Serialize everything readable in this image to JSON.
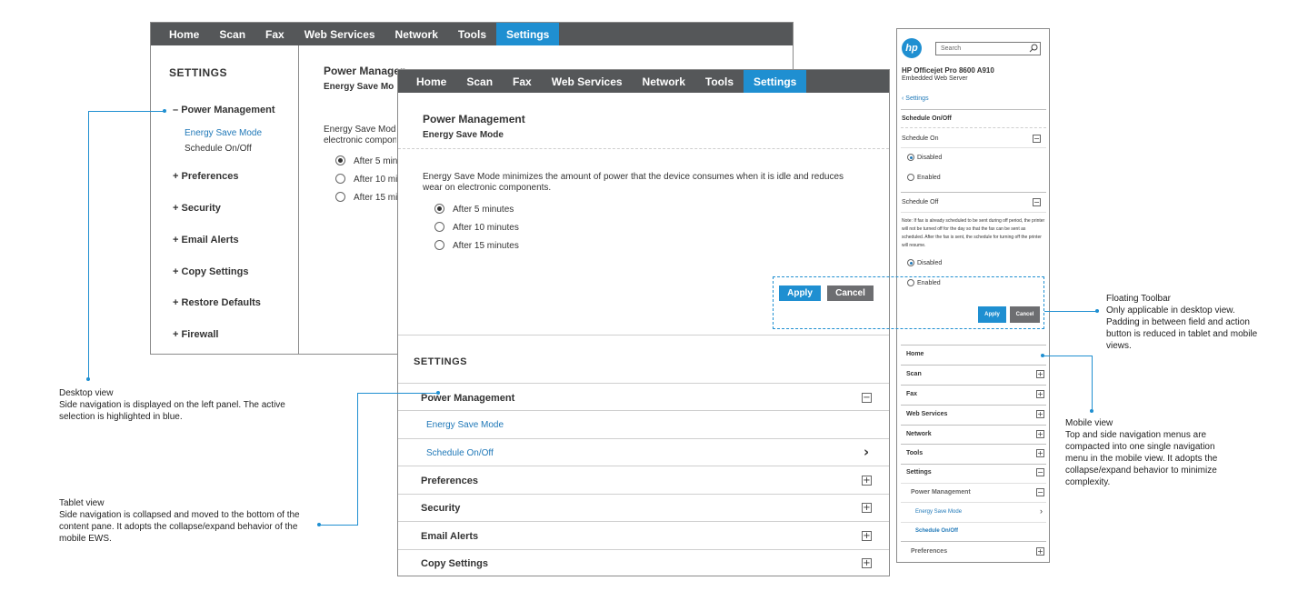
{
  "nav_tabs": [
    "Home",
    "Scan",
    "Fax",
    "Web Services",
    "Network",
    "Tools",
    "Settings"
  ],
  "active_tab": "Settings",
  "colors": {
    "nav_bg": "#555759",
    "accent": "#1f8fd1",
    "link": "#1f78b8",
    "cancel": "#6d6e71"
  },
  "desktop": {
    "side_title": "SETTINGS",
    "side_items": [
      {
        "label": "Power Management",
        "prefix": "–"
      },
      {
        "label": "Preferences",
        "prefix": "+"
      },
      {
        "label": "Security",
        "prefix": "+"
      },
      {
        "label": "Email Alerts",
        "prefix": "+"
      },
      {
        "label": "Copy Settings",
        "prefix": "+"
      },
      {
        "label": "Restore Defaults",
        "prefix": "+"
      },
      {
        "label": "Firewall",
        "prefix": "+"
      }
    ],
    "sub_items": [
      "Energy Save Mode",
      "Schedule On/Off"
    ],
    "content_title": "Power Managem",
    "content_subtitle": "Energy Save Mo",
    "content_desc_1": "Energy Save Mode m",
    "content_desc_2": "electronic compone",
    "options": [
      "After 5 min",
      "After 10 mi",
      "After 15 mi"
    ]
  },
  "tablet": {
    "title": "Power Management",
    "subtitle": "Energy Save Mode",
    "description": "Energy Save Mode minimizes the amount of power that the device consumes when it is idle and reduces wear on electronic components.",
    "options": [
      "After 5 minutes",
      "After 10 minutes",
      "After 15 minutes"
    ],
    "apply": "Apply",
    "cancel": "Cancel",
    "settings_title": "SETTINGS",
    "rows": [
      {
        "label": "Power Management",
        "icon": "−"
      },
      {
        "label": "Energy Save Mode",
        "sub": true
      },
      {
        "label": "Schedule On/Off",
        "sub": true,
        "chevron": "›"
      },
      {
        "label": "Preferences",
        "icon": "+"
      },
      {
        "label": "Security",
        "icon": "+"
      },
      {
        "label": "Email Alerts",
        "icon": "+"
      },
      {
        "label": "Copy Settings",
        "icon": "+"
      }
    ]
  },
  "mobile": {
    "logo": "hp",
    "search_placeholder": "Search",
    "device_name": "HP Officejet Pro 8600 A910",
    "device_sub": "Embedded Web Server",
    "back": "Settings",
    "section": "Schedule On/Off",
    "schedule_on": "Schedule On",
    "disabled": "Disabled",
    "enabled": "Enabled",
    "schedule_off": "Schedule Off",
    "note": "Note: If fax is already scheduled to be sent during off period, the printer will not be turned off for the day so that the fax can be sent as scheduled. After the fax is sent, the schedule for turning off the printer will resume.",
    "apply": "Apply",
    "cancel": "Cancel",
    "menu": [
      {
        "label": "Home",
        "icon": ""
      },
      {
        "label": "Scan",
        "icon": "+"
      },
      {
        "label": "Fax",
        "icon": "+"
      },
      {
        "label": "Web Services",
        "icon": "+"
      },
      {
        "label": "Network",
        "icon": "+"
      },
      {
        "label": "Tools",
        "icon": "+"
      },
      {
        "label": "Settings",
        "icon": "−"
      },
      {
        "label": "Power Management",
        "icon": "−",
        "level": 1
      },
      {
        "label": "Energy Save Mode",
        "icon": "›",
        "level": 2
      },
      {
        "label": "Schedule On/Off",
        "icon": "",
        "level": 2,
        "bold": true
      },
      {
        "label": "Preferences",
        "icon": "+",
        "level": 1
      }
    ]
  },
  "annotations": {
    "desktop": {
      "title": "Desktop view",
      "body": "Side navigation is displayed on the left panel. The active selection is highlighted in blue."
    },
    "tablet": {
      "title": "Tablet view",
      "body": "Side navigation is collapsed and moved to the bottom of the content pane. It adopts the collapse/expand behavior of the mobile EWS."
    },
    "toolbar": {
      "title": "Floating Toolbar",
      "body": "Only applicable in desktop view. Padding in between field and action button is reduced in tablet and mobile views."
    },
    "mobile": {
      "title": "Mobile view",
      "body": "Top and side navigation menus are compacted into one single navigation menu in the mobile view. It adopts the collapse/expand behavior to minimize complexity."
    }
  }
}
